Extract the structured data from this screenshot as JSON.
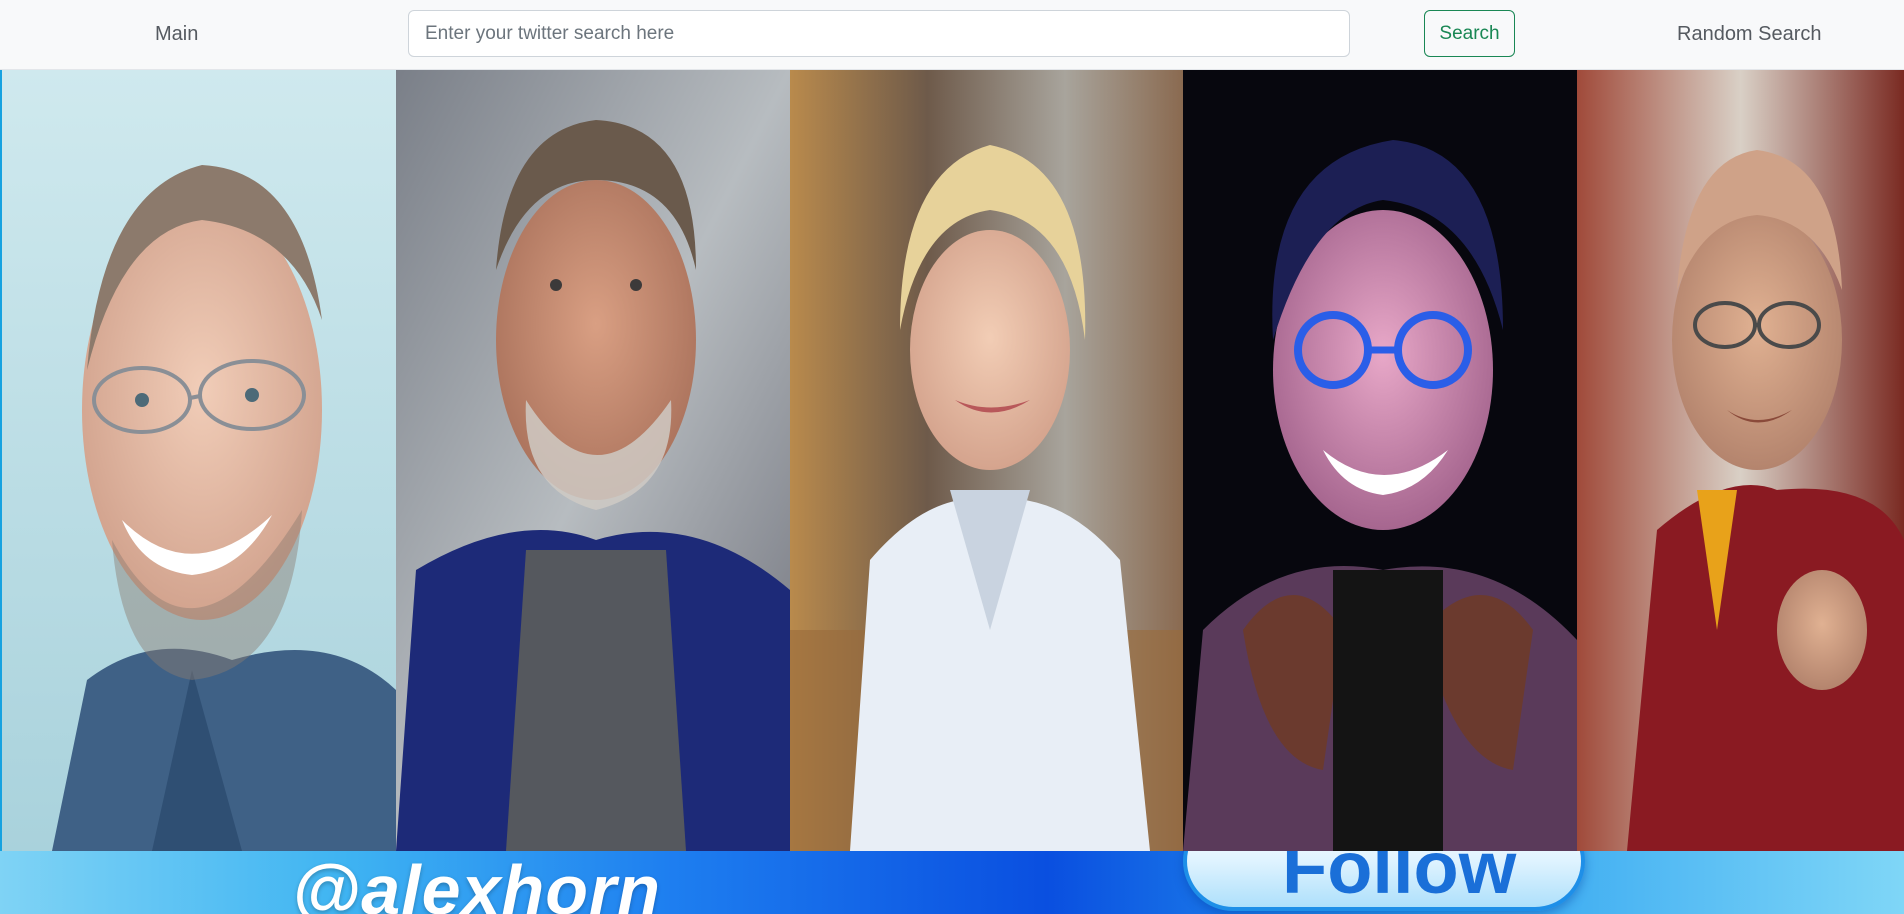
{
  "navbar": {
    "main_link": "Main",
    "search_placeholder": "Enter your twitter search here",
    "search_value": "",
    "search_button": "Search",
    "random_link": "Random Search"
  },
  "gallery": {
    "portraits": [
      {
        "subject": "man-with-glasses-blue-shirt",
        "background": "#bfe3ea"
      },
      {
        "subject": "older-man-blue-blazer",
        "background": "#9aa0a8"
      },
      {
        "subject": "woman-white-shirt",
        "background": "#8a6a4c"
      },
      {
        "subject": "man-round-blue-glasses",
        "background": "#0a0a14"
      },
      {
        "subject": "monk-red-robe",
        "background": "#7a2a22"
      }
    ]
  },
  "banner": {
    "handle": "@alexhorn",
    "follow": "Follow"
  },
  "colors": {
    "accent_success": "#198754",
    "navbar_bg": "#f8f9fa"
  }
}
